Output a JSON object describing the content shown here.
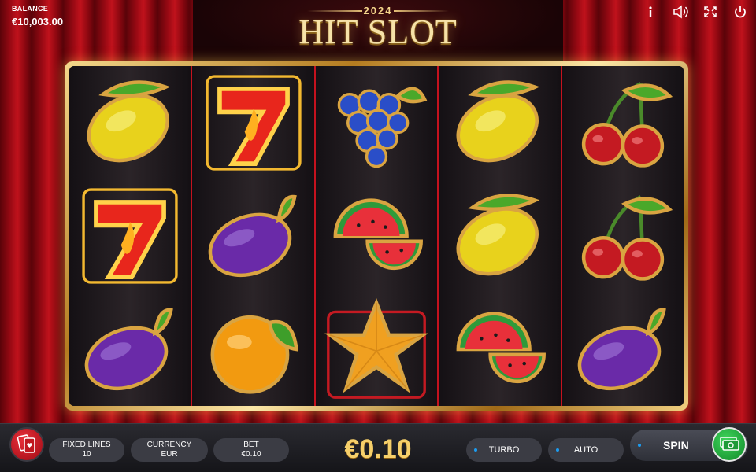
{
  "logo": {
    "year": "2024",
    "name": "HIT SLOT"
  },
  "balance": {
    "label": "BALANCE",
    "value": "€10,003.00"
  },
  "top_icons": [
    "info-icon",
    "sound-icon",
    "fullscreen-icon",
    "power-icon"
  ],
  "reels": [
    [
      "lemon",
      "seven",
      "plum"
    ],
    [
      "seven",
      "plum",
      "orange"
    ],
    [
      "grapes",
      "watermelon",
      "star"
    ],
    [
      "lemon",
      "lemon",
      "watermelon"
    ],
    [
      "cherries",
      "cherries",
      "plum"
    ]
  ],
  "bottom": {
    "fixed_lines": {
      "label": "FIXED LINES",
      "value": "10"
    },
    "currency": {
      "label": "CURRENCY",
      "value": "EUR"
    },
    "bet": {
      "label": "BET",
      "value": "€0.10"
    },
    "bet_amount": "€0.10",
    "turbo": "TURBO",
    "auto": "AUTO",
    "spin": "SPIN"
  },
  "colors": {
    "accent_gold": "#f6cf6a",
    "curtain_red": "#b0101a",
    "toggle_dot": "#1c9cf0",
    "spin_green": "#2bb545"
  }
}
